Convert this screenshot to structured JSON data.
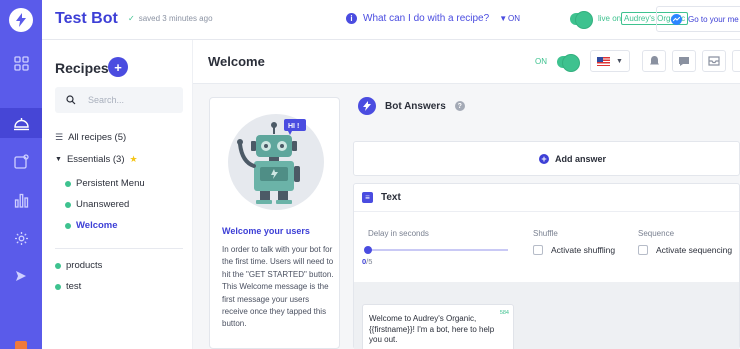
{
  "app": {
    "bot_name": "Test Bot",
    "saved_status": "saved 3 minutes ago",
    "help_link": "What can I do with a recipe?",
    "status_on": "ON",
    "live_on": "live on",
    "page_name": "Audrey's Organic",
    "goto_label": "Go to your me"
  },
  "rail": {
    "items": [
      "dashboard-icon",
      "recipes-icon",
      "broadcast-icon",
      "analytics-icon",
      "settings-icon",
      "send-icon"
    ],
    "active": "recipes-icon"
  },
  "recipes": {
    "title": "Recipes",
    "search_placeholder": "Search...",
    "all_recipes": "All recipes (5)",
    "essentials": "Essentials (3)",
    "essential_items": [
      "Persistent Menu",
      "Unanswered",
      "Welcome"
    ],
    "active_item": "Welcome",
    "other_items": [
      "products",
      "test"
    ]
  },
  "main": {
    "title": "Welcome",
    "on_label": "ON",
    "language": "en-US"
  },
  "welcome_card": {
    "badge": "HI !",
    "title": "Welcome your users",
    "description": "In order to talk with your bot for the first time. Users will need to hit the \"GET STARTED\" button. This Welcome message is the first message your users receive once they tapped this button."
  },
  "answers": {
    "section_title": "Bot Answers",
    "add_answer": "Add answer",
    "text_block": {
      "title": "Text",
      "delay_label": "Delay in seconds",
      "delay_value": "0",
      "delay_max": "/5",
      "delay_fraction": 0,
      "shuffle_label": "Shuffle",
      "shuffle_option": "Activate shuffling",
      "sequence_label": "Sequence",
      "sequence_option": "Activate sequencing",
      "message": "Welcome to Audrey's Organic, {{firstname}}! I'm a bot, here to help you out.",
      "char_count": "584"
    }
  },
  "colors": {
    "brand": "#5a5bea",
    "accent": "#3d3fd6",
    "success": "#3ec28f"
  }
}
